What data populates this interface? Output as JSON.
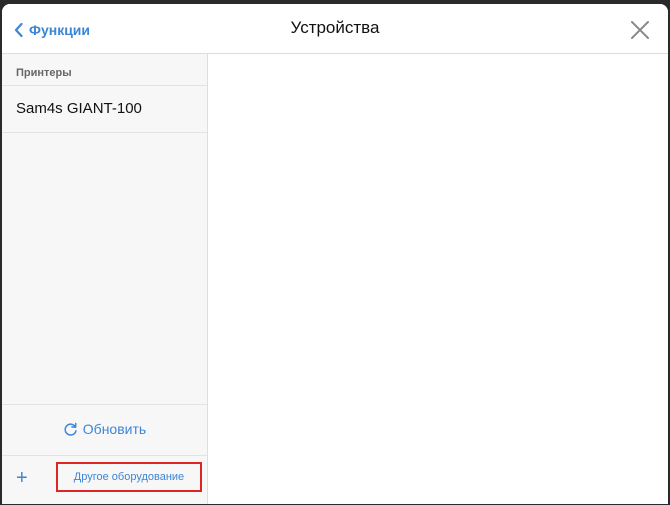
{
  "nav": {
    "back_label": "Функции",
    "title": "Устройства"
  },
  "sidebar": {
    "section_title": "Принтеры",
    "items": [
      {
        "label": "Sam4s GIANT-100"
      }
    ],
    "refresh_label": "Обновить",
    "add_symbol": "+",
    "other_equipment_label": "Другое оборудование"
  },
  "colors": {
    "accent": "#3b86d6",
    "highlight_border": "#e02424"
  },
  "icons": {
    "back": "chevron-left-icon",
    "close": "close-icon",
    "refresh": "refresh-icon",
    "add": "plus-icon"
  }
}
